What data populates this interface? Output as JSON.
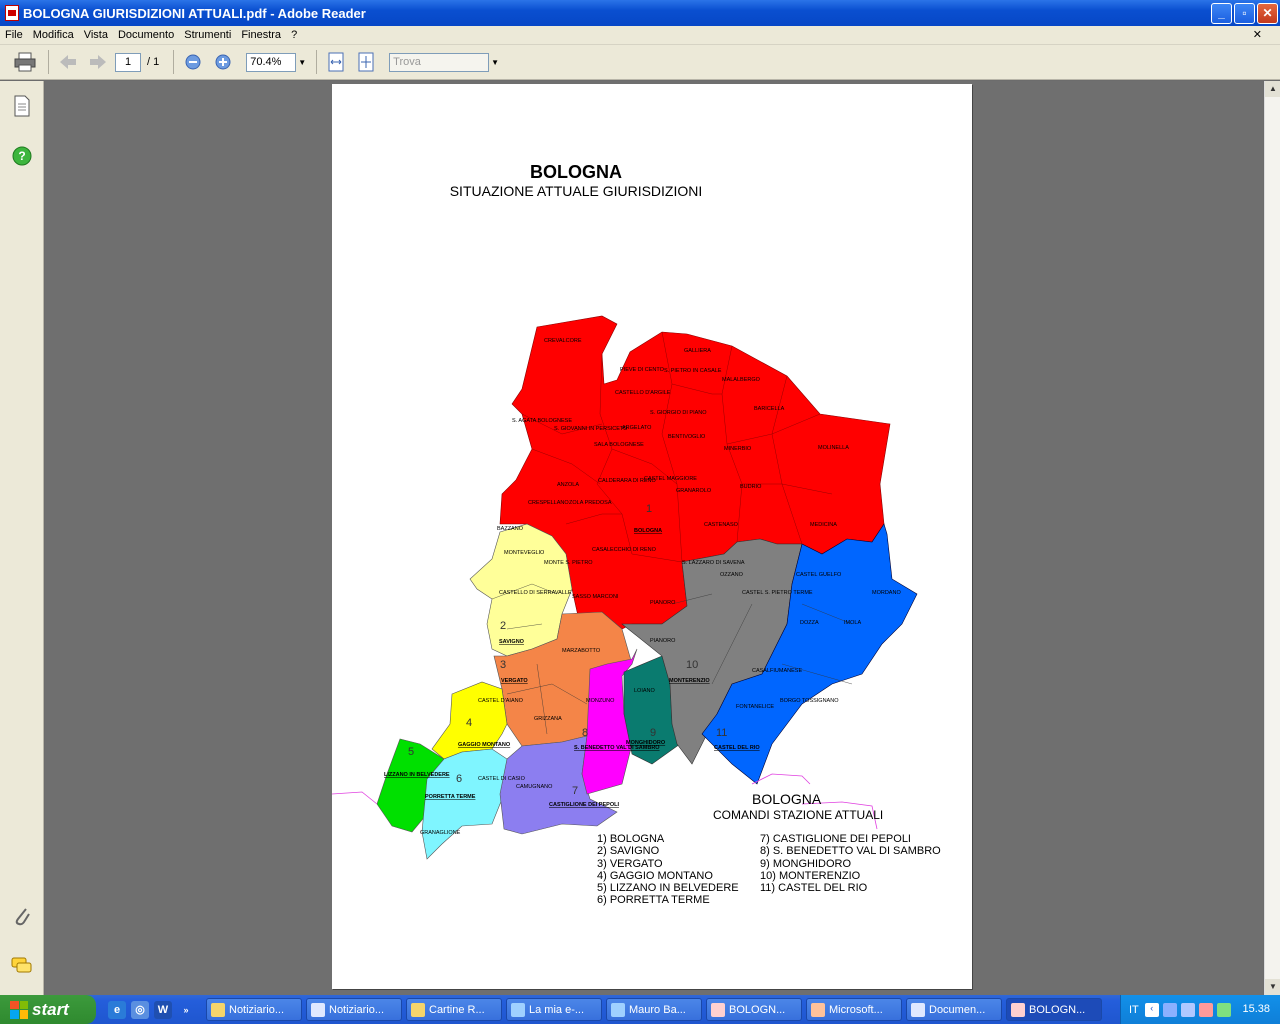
{
  "window": {
    "title": "BOLOGNA GIURISDIZIONI ATTUALI.pdf - Adobe Reader"
  },
  "menu": [
    "File",
    "Modifica",
    "Vista",
    "Documento",
    "Strumenti",
    "Finestra",
    "?"
  ],
  "toolbar": {
    "page_current": "1",
    "page_total": "/ 1",
    "zoom": "70.4%",
    "find_placeholder": "Trova"
  },
  "page": {
    "title": "BOLOGNA",
    "subtitle": "SITUAZIONE ATTUALE GIURISDIZIONI",
    "legend_title": "BOLOGNA",
    "legend_subtitle": "COMANDI STAZIONE ATTUALI",
    "legend_left": [
      "1)    BOLOGNA",
      "2)    SAVIGNO",
      "3)    VERGATO",
      "4)    GAGGIO MONTANO",
      "5)    LIZZANO IN BELVEDERE",
      "6)    PORRETTA TERME"
    ],
    "legend_right": [
      "7)  CASTIGLIONE DEI PEPOLI",
      "8)  S. BENEDETTO VAL DI SAMBRO",
      "9)  MONGHIDORO",
      "10) MONTERENZIO",
      "11) CASTEL DEL RIO"
    ],
    "map_labels": {
      "crevalcore": "CREVALCORE",
      "galliera": "GALLIERA",
      "pieve": "PIEVE DI CENTO",
      "spietro": "S. PIETRO IN CASALE",
      "malalbergo": "MALALBERGO",
      "castello_argile": "CASTELLO D'ARGILE",
      "agata": "S. AGATA BOLOGNESE",
      "sgiovanni": "S. GIOVANNI IN PERSICETO",
      "argelato": "ARGELATO",
      "sgiorgio": "S. GIORGIO DI PIANO",
      "baricella": "BARICELLA",
      "bentivoglio": "BENTIVOGLIO",
      "minerbio": "MINERBIO",
      "molinella": "MOLINELLA",
      "sala": "SALA BOLOGNESE",
      "calderara": "CALDERARA DI RENO",
      "anzola": "ANZOLA",
      "castel_maggiore": "CASTEL MAGGIORE",
      "granarolo": "GRANAROLO",
      "budrio": "BUDRIO",
      "crespellano": "CRESPELLANO",
      "castenaso": "CASTENASO",
      "bazzano": "BAZZANO",
      "zola": "ZOLA PREDOSA",
      "bologna": "BOLOGNA",
      "medicina": "MEDICINA",
      "casalecchio": "CASALECCHIO DI RENO",
      "monteveglio": "MONTEVEGLIO",
      "montesp": "MONTE S. PIETRO",
      "slazzaro": "S. LAZZARO DI SAVENA",
      "ozzano": "OZZANO",
      "castel_guelfo": "CASTEL GUELFO",
      "castello_serravalle": "CASTELLO DI SERRAVALLE",
      "sasso": "SASSO MARCONI",
      "pianoro_lab": "PIANORO",
      "castel_sp": "CASTEL S. PIETRO TERME",
      "mordano": "MORDANO",
      "dozza": "DOZZA",
      "imola": "IMOLA",
      "savigno": "SAVIGNO",
      "marzabotto": "MARZABOTTO",
      "pianoro": "PIANORO",
      "monterenzio": "MONTERENZIO",
      "casalfiumanese": "CASALFIUMANESE",
      "vergato": "VERGATO",
      "loiano": "LOIANO",
      "castel_aiano": "CASTEL D'AIANO",
      "monzuno": "MONZUNO",
      "borgo": "BORGO TOSSIGNANO",
      "fontanelice": "FONTANELICE",
      "grizzana": "GRIZZANA",
      "gaggio": "GAGGIO MONTANO",
      "monghidoro": "MONGHIDORO",
      "castel_rio": "CASTEL DEL RIO",
      "sbenedetto": "S. BENEDETTO VAL DI SAMBRO",
      "lizzano": "LIZZANO IN BELVEDERE",
      "castel_casio": "CASTEL DI CASIO",
      "camugnano": "CAMUGNANO",
      "porretta": "PORRETTA TERME",
      "castiglione": "CASTIGLIONE DEI PEPOLI",
      "granaglione": "GRANAGLIONE",
      "n1": "1",
      "n2": "2",
      "n3": "3",
      "n4": "4",
      "n5": "5",
      "n6": "6",
      "n7": "7",
      "n8": "8",
      "n9": "9",
      "n10": "10",
      "n11": "11"
    }
  },
  "taskbar": {
    "start": "start",
    "tasks": [
      "Notiziario...",
      "Notiziario...",
      "Cartine R...",
      "La mia e-...",
      "Mauro Ba...",
      "BOLOGN...",
      "Microsoft...",
      "Documen...",
      "BOLOGN..."
    ],
    "lang": "IT",
    "clock": "15.38"
  },
  "colors": {
    "red": "#ff0000",
    "yellow": "#ffff99",
    "gold": "#ffff00",
    "orange": "#f48548",
    "magenta": "#ff00ff",
    "teal": "#0a7b6f",
    "gray": "#808080",
    "blue": "#0066ff",
    "green": "#00e000",
    "cyan": "#7ff5ff",
    "lavender": "#8c7ef0"
  },
  "icons": [
    "pdf-icon",
    "print-icon",
    "prev-page-icon",
    "next-page-icon",
    "zoom-out-icon",
    "zoom-in-icon",
    "fit-width-icon",
    "fit-page-icon",
    "pages-icon",
    "help-icon",
    "attachment-icon",
    "comments-icon"
  ]
}
